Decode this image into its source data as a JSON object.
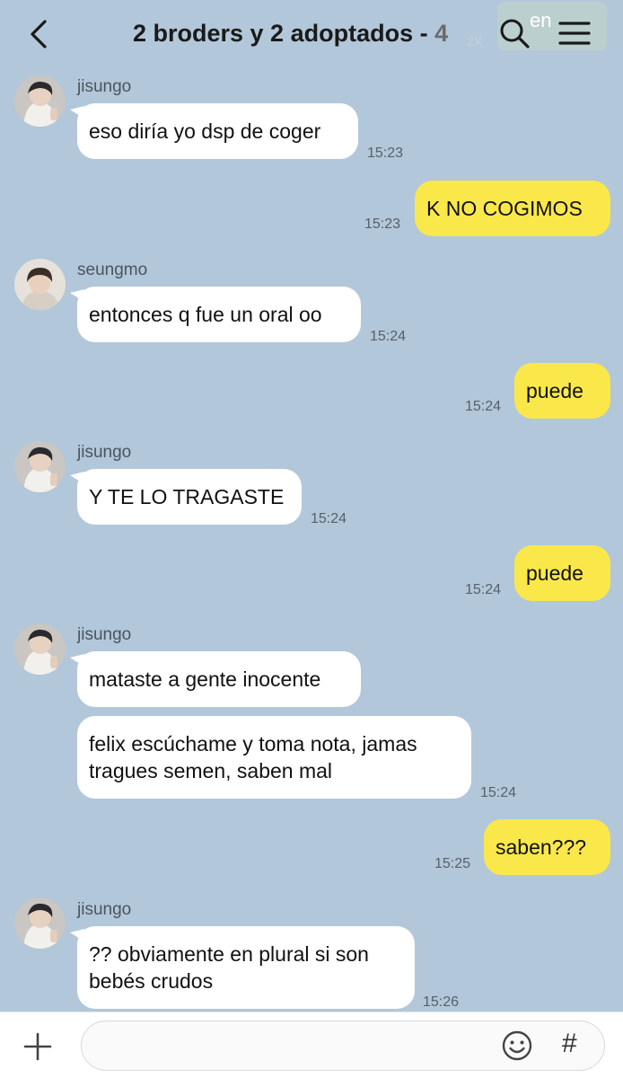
{
  "header": {
    "title": "2 broders y 2 adoptados - ",
    "member_count": "4",
    "ghost_text": "en",
    "ghost_num": "2X"
  },
  "messages": [
    {
      "sender": "jisungo",
      "text": "eso diría yo dsp de coger",
      "time": "15:23"
    },
    {
      "text": "K NO COGIMOS",
      "time": "15:23"
    },
    {
      "sender": "seungmo",
      "text": "entonces q fue un oral oo",
      "time": "15:24"
    },
    {
      "text": "puede",
      "time": "15:24"
    },
    {
      "sender": "jisungo",
      "text": "Y TE LO TRAGASTE",
      "time": "15:24"
    },
    {
      "text": "puede",
      "time": "15:24"
    },
    {
      "sender": "jisungo",
      "text": "mataste a gente inocente"
    },
    {
      "text": "felix escúchame y toma nota, jamas tragues semen, saben mal",
      "time": "15:24"
    },
    {
      "text": "saben???",
      "time": "15:25"
    },
    {
      "sender": "jisungo",
      "text": "?? obviamente en plural si son bebés crudos",
      "time": "15:26"
    }
  ],
  "composer": {
    "value": "",
    "hash_symbol": "#"
  },
  "icons": {
    "back": "chevron-left-icon",
    "search": "search-icon",
    "menu": "hamburger-menu-icon",
    "plus": "plus-icon",
    "emoji": "smiley-icon"
  },
  "colors": {
    "background": "#b2c7d9",
    "incoming_bubble": "#ffffff",
    "outgoing_bubble": "#fae84a"
  }
}
